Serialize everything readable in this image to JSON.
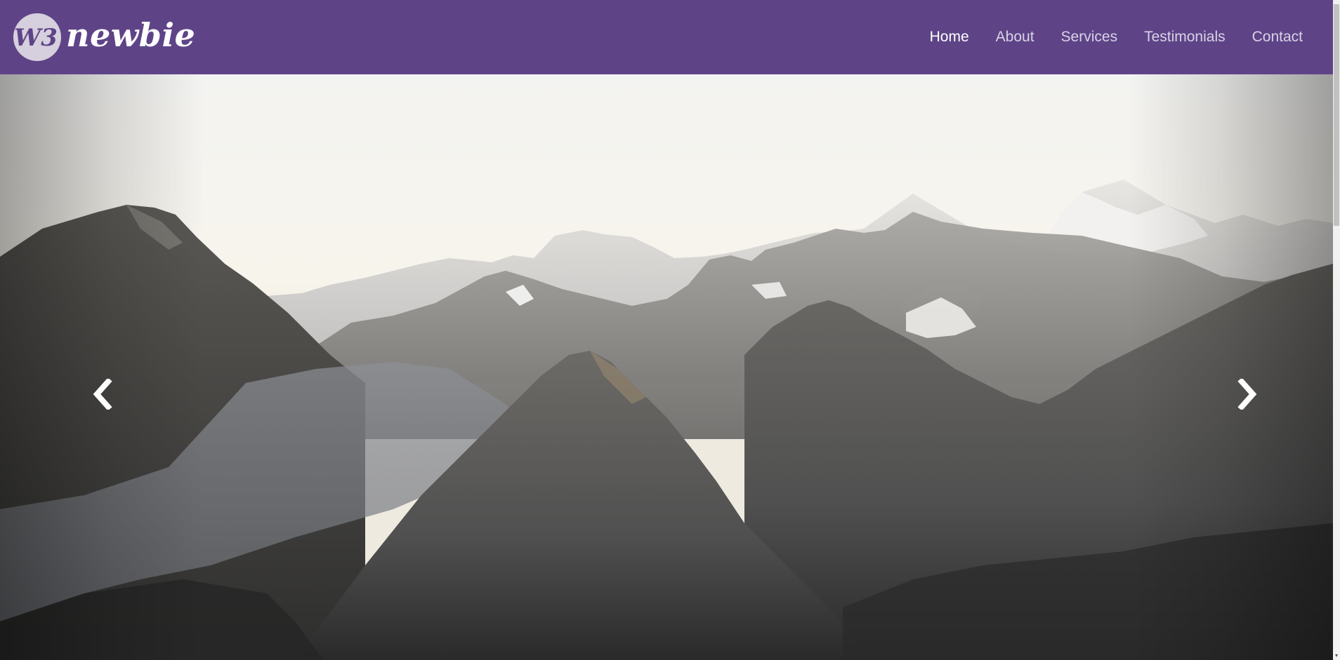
{
  "brand": {
    "name": "newbie",
    "logo_icon": "w3-circle-logo-icon"
  },
  "nav": {
    "items": [
      {
        "label": "Home",
        "active": true
      },
      {
        "label": "About",
        "active": false
      },
      {
        "label": "Services",
        "active": false
      },
      {
        "label": "Testimonials",
        "active": false
      },
      {
        "label": "Contact",
        "active": false
      }
    ]
  },
  "carousel": {
    "image": "mountain-range-photo",
    "prev_icon": "chevron-left-icon",
    "next_icon": "chevron-right-icon"
  },
  "colors": {
    "navbar": "#5e4487",
    "nav_text": "#d9d2e6",
    "nav_active": "#ffffff"
  }
}
